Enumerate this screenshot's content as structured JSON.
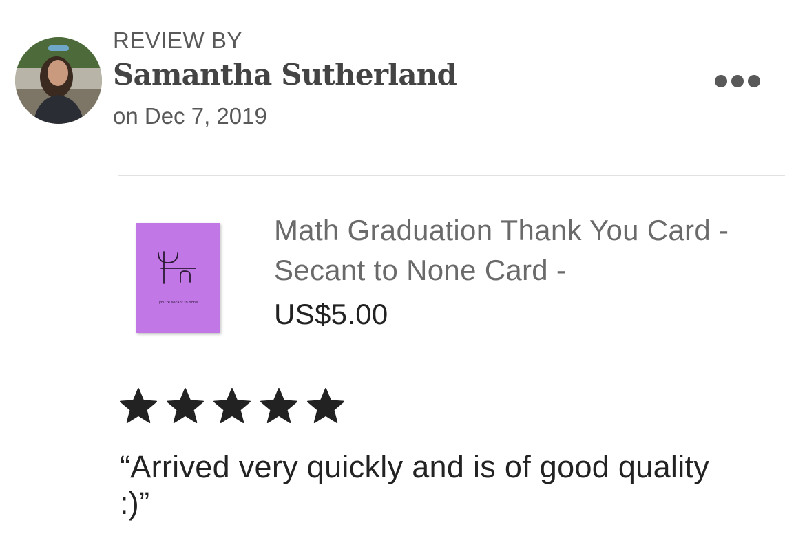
{
  "review": {
    "header_label": "REVIEW BY",
    "reviewer_name": "Samantha Sutherland",
    "date": "on Dec 7, 2019",
    "rating": 5,
    "rating_max": 5,
    "text": "“Arrived very quickly and is of good quality :)”"
  },
  "product": {
    "title": "Math Graduation Thank You Card - Secant to None Card -",
    "price": "US$5.00",
    "card_caption": "you're secant to none",
    "card_color": "#c277e6"
  },
  "menu": {
    "icon": "more-horizontal-icon"
  },
  "colors": {
    "star": "#222222",
    "text_muted": "#595959",
    "divider": "#e2e2e2"
  }
}
